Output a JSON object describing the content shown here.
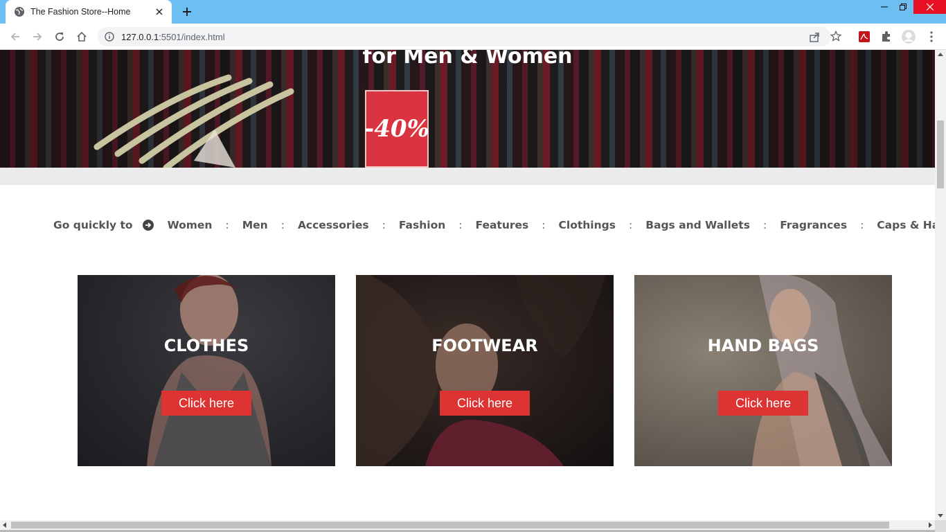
{
  "browser": {
    "tab_title": "The Fashion Store--Home",
    "url_host": "127.0.0.1",
    "url_rest": ":5501/index.html"
  },
  "hero": {
    "heading": "for Men & Women",
    "sale_text": "-40%"
  },
  "quicknav": {
    "label": "Go quickly to",
    "links": [
      "Women",
      "Men",
      "Accessories",
      "Fashion",
      "Features",
      "Clothings",
      "Bags and Wallets",
      "Fragrances",
      "Caps & Hats"
    ],
    "separator": ":"
  },
  "cards": [
    {
      "title": "CLOTHES",
      "button": "Click here"
    },
    {
      "title": "FOOTWEAR",
      "button": "Click here"
    },
    {
      "title": "HAND BAGS",
      "button": "Click here"
    }
  ],
  "colors": {
    "titlebar": "#6cbff0",
    "accent_button": "#dd3333",
    "nav_text": "#555555"
  }
}
